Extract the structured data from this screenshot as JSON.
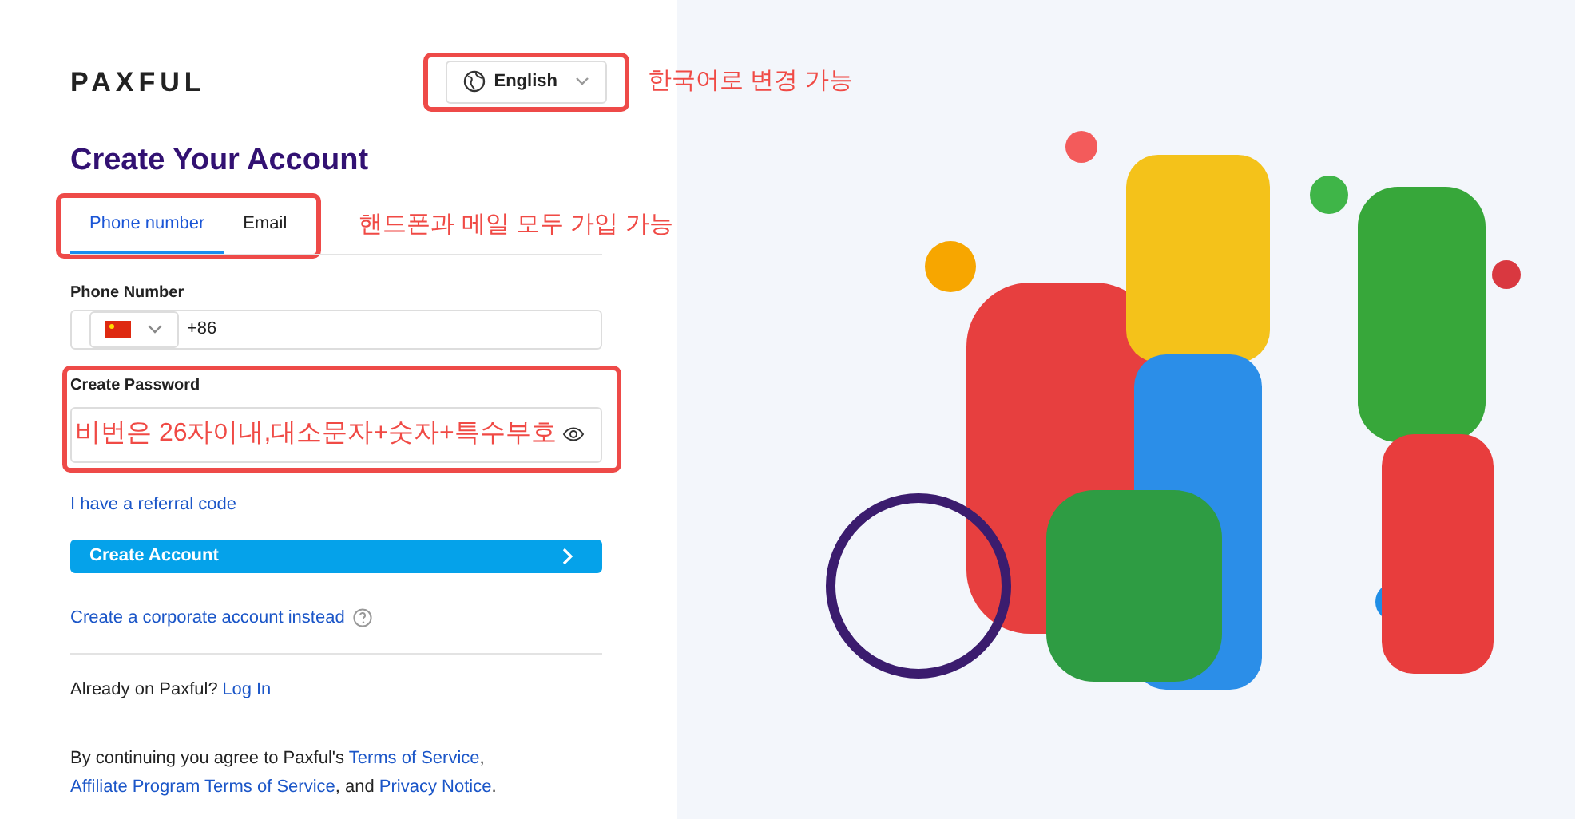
{
  "logo": "PAXFUL",
  "language_selector": {
    "label": "English"
  },
  "heading": "Create Your Account",
  "tabs": [
    {
      "label": "Phone number",
      "selected": true
    },
    {
      "label": "Email",
      "selected": false
    }
  ],
  "phone_field": {
    "label": "Phone Number",
    "country_code": "+86"
  },
  "password_field": {
    "label": "Create Password"
  },
  "referral_link": "I have a referral code",
  "create_button": "Create Account",
  "corporate_link": "Create a corporate account instead",
  "login": {
    "text": "Already on Paxful?",
    "link": "Log In"
  },
  "legal": [
    {
      "kind": "text",
      "text": "By continuing you agree to Paxful's"
    },
    {
      "kind": "link",
      "text": "Terms of Service"
    },
    {
      "kind": "text",
      "text": ","
    },
    {
      "kind": "link",
      "text": "Affiliate Program Terms of Service"
    },
    {
      "kind": "text",
      "text": ", and"
    },
    {
      "kind": "link",
      "text": "Privacy Notice"
    },
    {
      "kind": "text",
      "text": "."
    }
  ],
  "annotations": [
    {
      "text": "한국어로 변경 가능"
    },
    {
      "text": "핸드폰과 메일 모두 가입 가능"
    },
    {
      "text": "비번은 26자이내,대소문자+숫자+특수부호"
    }
  ]
}
